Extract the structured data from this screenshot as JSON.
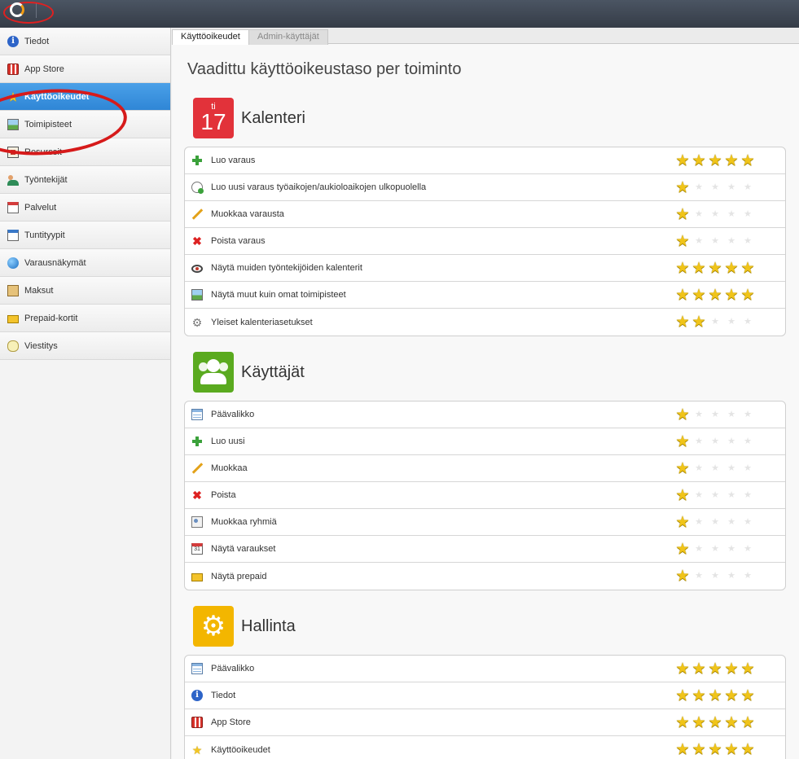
{
  "topbar": {
    "logo": "app-logo"
  },
  "tabs": [
    {
      "label": "Käyttöoikeudet",
      "active": true
    },
    {
      "label": "Admin-käyttäjät",
      "active": false
    }
  ],
  "sidebar": {
    "items": [
      {
        "label": "Tiedot",
        "icon": "info-icon"
      },
      {
        "label": "App Store",
        "icon": "store-icon"
      },
      {
        "label": "Käyttöoikeudet",
        "icon": "star-icon",
        "active": true
      },
      {
        "label": "Toimipisteet",
        "icon": "picture-icon"
      },
      {
        "label": "Resurssit",
        "icon": "house-icon"
      },
      {
        "label": "Työntekijät",
        "icon": "people-icon"
      },
      {
        "label": "Palvelut",
        "icon": "calendar-icon"
      },
      {
        "label": "Tuntityypit",
        "icon": "calendar-icon"
      },
      {
        "label": "Varausnäkymät",
        "icon": "globe-icon"
      },
      {
        "label": "Maksut",
        "icon": "money-icon"
      },
      {
        "label": "Prepaid-kortit",
        "icon": "card-icon"
      },
      {
        "label": "Viestitys",
        "icon": "chat-icon"
      }
    ]
  },
  "main": {
    "title": "Vaadittu käyttöoikeustaso per toiminto",
    "sections": [
      {
        "title": "Kalenteri",
        "icon": {
          "day": "ti",
          "number": "17"
        },
        "rows": [
          {
            "label": "Luo varaus",
            "icon": "plus-icon",
            "level": 5
          },
          {
            "label": "Luo uusi varaus työaikojen/aukioloaikojen ulkopuolella",
            "icon": "clock-icon",
            "level": 1
          },
          {
            "label": "Muokkaa varausta",
            "icon": "pencil-icon",
            "level": 1
          },
          {
            "label": "Poista varaus",
            "icon": "delete-icon",
            "level": 1
          },
          {
            "label": "Näytä muiden työntekijöiden kalenterit",
            "icon": "eye-icon",
            "level": 5
          },
          {
            "label": "Näytä muut kuin omat toimipisteet",
            "icon": "picture-icon",
            "level": 5
          },
          {
            "label": "Yleiset kalenteriasetukset",
            "icon": "gear-icon",
            "level": 2
          }
        ]
      },
      {
        "title": "Käyttäjät",
        "rows": [
          {
            "label": "Päävalikko",
            "icon": "window-icon",
            "level": 1
          },
          {
            "label": "Luo uusi",
            "icon": "plus-icon",
            "level": 1
          },
          {
            "label": "Muokkaa",
            "icon": "pencil-icon",
            "level": 1
          },
          {
            "label": "Poista",
            "icon": "delete-icon",
            "level": 1
          },
          {
            "label": "Muokkaa ryhmiä",
            "icon": "group-icon",
            "level": 1
          },
          {
            "label": "Näytä varaukset",
            "icon": "calendar-icon",
            "level": 1
          },
          {
            "label": "Näytä prepaid",
            "icon": "card-icon",
            "level": 1
          }
        ]
      },
      {
        "title": "Hallinta",
        "rows": [
          {
            "label": "Päävalikko",
            "icon": "window-icon",
            "level": 5
          },
          {
            "label": "Tiedot",
            "icon": "info-icon",
            "level": 5
          },
          {
            "label": "App Store",
            "icon": "store-icon",
            "level": 5
          },
          {
            "label": "Käyttöoikeudet",
            "icon": "star-icon",
            "level": 5
          }
        ]
      }
    ]
  },
  "colors": {
    "active_sidebar": "#3a8fdc",
    "star": "#f0c419",
    "annotation": "#d61a1a"
  }
}
